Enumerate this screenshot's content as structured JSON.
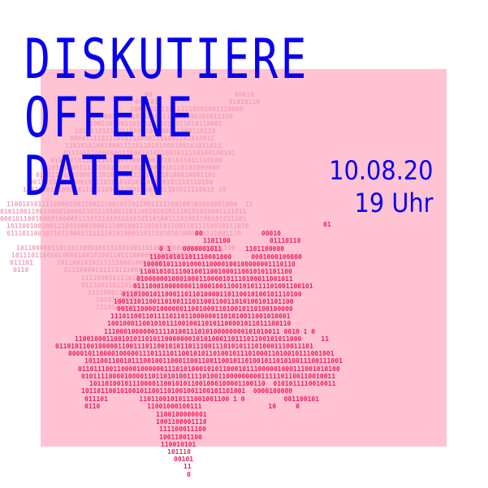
{
  "title": {
    "lines": [
      "DISKUTIERE",
      "OFFENE",
      "DATEN"
    ]
  },
  "event": {
    "date": "10.08.20",
    "time": "19 Uhr"
  },
  "colors": {
    "accent": "#0a00f0",
    "panel": "#ffc3d4",
    "binary": "#e8245e"
  }
}
